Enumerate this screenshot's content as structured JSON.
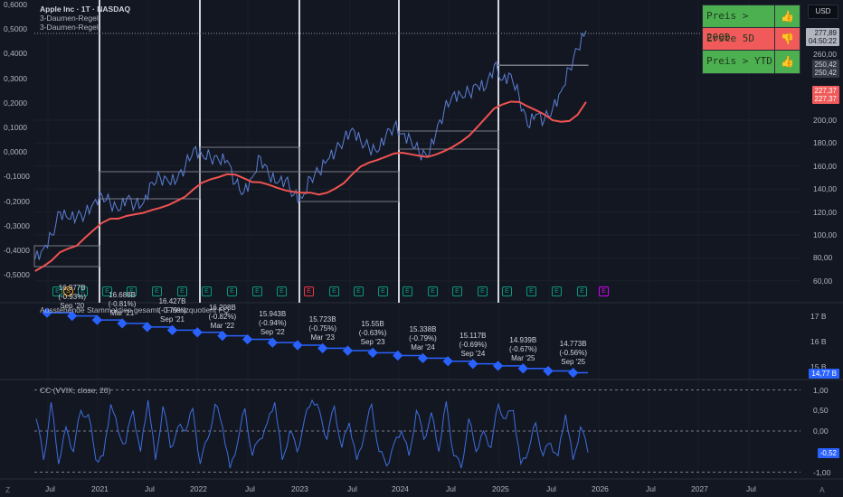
{
  "legend": {
    "title": "Apple Inc · 1T · NASDAQ",
    "line1": "3-Daumen-Regel",
    "line2": "3-Daumen-Regel"
  },
  "currency_button": "USD",
  "signal_table": [
    {
      "label": "Preis > 200D",
      "status": "green",
      "icon": "thumbs-up-icon",
      "glyph": "👍"
    },
    {
      "label": "Erste 5D",
      "status": "red",
      "icon": "thumbs-down-icon",
      "glyph": "👎"
    },
    {
      "label": "Preis > YTD",
      "status": "green",
      "icon": "thumbs-up-icon",
      "glyph": "👍"
    }
  ],
  "colors": {
    "bg": "#131722",
    "price": "#5b7fd6",
    "sma": "#ef5350",
    "shares": "#2962ff",
    "cc": "#3d6ee0",
    "green": "#4caf50",
    "red": "#f05a5a"
  },
  "price_tags": {
    "last": "277,89",
    "countdown": "04:50:22",
    "level_a": "250,42",
    "level_b": "250,42",
    "sma_a": "227,37",
    "sma_b": "227,37",
    "mid": "260,00"
  },
  "right_axis": [
    "200,00",
    "180,00",
    "160,00",
    "140,00",
    "120,00",
    "100,00",
    "80,00",
    "60,00"
  ],
  "left_axis": [
    "0,6000",
    "0,5000",
    "0,4000",
    "0,3000",
    "0,2000",
    "0,1000",
    "0,0000",
    "-0,1000",
    "-0,2000",
    "-0,3000",
    "-0,4000",
    "-0,5000"
  ],
  "time_axis": [
    "Jul",
    "2021",
    "Jul",
    "2022",
    "Jul",
    "2023",
    "Jul",
    "2024",
    "Jul",
    "2025",
    "Jul",
    "2026",
    "Jul",
    "2027",
    "Jul"
  ],
  "events": [
    "E",
    "S",
    "E",
    "E",
    "E",
    "E",
    "E",
    "E",
    "E",
    "E",
    "E",
    "E",
    "E",
    "E",
    "E",
    "E",
    "E",
    "E",
    "E",
    "E",
    "E",
    "E",
    "E",
    "E"
  ],
  "chart_data": [
    {
      "type": "line",
      "title": "Apple Inc · 1T · NASDAQ",
      "start": "May 2020",
      "step": "1 month",
      "values": [
        79,
        88,
        100,
        120,
        114,
        116,
        118,
        128,
        135,
        128,
        121,
        132,
        126,
        128,
        146,
        150,
        146,
        148,
        160,
        175,
        170,
        168,
        165,
        165,
        145,
        137,
        150,
        168,
        152,
        145,
        148,
        135,
        132,
        150,
        155,
        165,
        173,
        183,
        193,
        182,
        176,
        172,
        186,
        195,
        188,
        183,
        172,
        168,
        188,
        208,
        222,
        222,
        224,
        230,
        228,
        248,
        235,
        240,
        220,
        195,
        205,
        200,
        210,
        225,
        245,
        262,
        277.89
      ],
      "ylim": [
        50,
        290
      ],
      "series_name": "Price",
      "overlay": "SMA 200"
    },
    {
      "type": "line",
      "title": "Ausstehende Stammaktien gesamt · Finanzquotient FQ",
      "axis": [
        "17 B",
        "16 B",
        "15 B"
      ],
      "last_tag": "14,77 B",
      "points": [
        {
          "v": 17.1,
          "label": ""
        },
        {
          "v": 16.977,
          "label": "16.977B",
          "chg": "(-0.93%)",
          "date": "Sep '20"
        },
        {
          "v": 16.82,
          "label": ""
        },
        {
          "v": 16.688,
          "label": "16.688B",
          "chg": "(-0.81%)",
          "date": "Mar '21"
        },
        {
          "v": 16.55,
          "label": ""
        },
        {
          "v": 16.427,
          "label": "16.427B",
          "chg": "(-0.79%)",
          "date": "Sep '21"
        },
        {
          "v": 16.34,
          "label": ""
        },
        {
          "v": 16.208,
          "label": "16.208B",
          "chg": "(-0.82%)",
          "date": "Mar '22"
        },
        {
          "v": 16.07,
          "label": ""
        },
        {
          "v": 15.943,
          "label": "15.943B",
          "chg": "(-0.94%)",
          "date": "Sep '22"
        },
        {
          "v": 15.84,
          "label": ""
        },
        {
          "v": 15.723,
          "label": "15.723B",
          "chg": "(-0.75%)",
          "date": "Mar '23"
        },
        {
          "v": 15.63,
          "label": ""
        },
        {
          "v": 15.55,
          "label": "15.55B",
          "chg": "(-0.63%)",
          "date": "Sep '23"
        },
        {
          "v": 15.44,
          "label": ""
        },
        {
          "v": 15.338,
          "label": "15.338B",
          "chg": "(-0.79%)",
          "date": "Mar '24"
        },
        {
          "v": 15.22,
          "label": ""
        },
        {
          "v": 15.117,
          "label": "15.117B",
          "chg": "(-0.69%)",
          "date": "Sep '24"
        },
        {
          "v": 15.04,
          "label": ""
        },
        {
          "v": 14.939,
          "label": "14.939B",
          "chg": "(-0.67%)",
          "date": "Mar '25"
        },
        {
          "v": 14.84,
          "label": ""
        },
        {
          "v": 14.773,
          "label": "14.773B",
          "chg": "(-0.56%)",
          "date": "Sep '25"
        }
      ]
    },
    {
      "type": "line",
      "title": "CC (VVIX, close, 20)",
      "axis": [
        "1,00",
        "0,50",
        "0,00",
        "-0,50",
        "-1,00"
      ],
      "last_tag": "-0,52",
      "ylim": [
        -1,
        1
      ],
      "values": [
        0.3,
        -0.7,
        0.7,
        -0.8,
        0.1,
        -0.5,
        0.5,
        0.4,
        -0.7,
        -0.6,
        0.65,
        0.0,
        -0.3,
        0.5,
        -0.5,
        0.75,
        -0.7,
        0.6,
        -0.4,
        0.1,
        0.0,
        0.55,
        -0.8,
        -0.2,
        0.65,
        0.1,
        -0.9,
        -0.3,
        0.55,
        -0.6,
        -0.2,
        0.2,
        0.7,
        -0.7,
        0.0,
        -0.5,
        0.3,
        0.75,
        0.5,
        -0.2,
        0.6,
        -0.4,
        0.2,
        -0.7,
        -0.1,
        0.65,
        -0.5,
        -0.85,
        -0.3,
        0.0,
        -0.6,
        0.5,
        -0.2,
        0.45,
        -0.5,
        0.72,
        -0.6,
        -0.9,
        0.3,
        -0.5,
        0.0,
        -0.4,
        0.65,
        0.3,
        0.5,
        -0.8,
        -0.5,
        0.2,
        -0.6,
        -0.3,
        -0.6,
        0.4,
        -0.7,
        0.1,
        -0.52
      ]
    }
  ]
}
